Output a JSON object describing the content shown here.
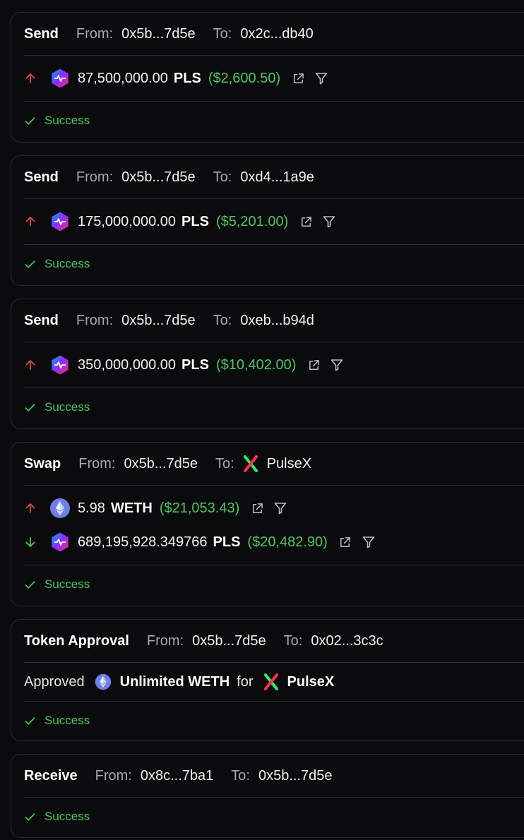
{
  "colors": {
    "success": "#4ec65f",
    "up_arrow": "#e0484b",
    "down_arrow": "#4ec65f",
    "background": "#0b0b0d"
  },
  "labels": {
    "from": "From:",
    "to": "To:"
  },
  "transactions": [
    {
      "type": "Send",
      "from": "0x5b...7d5e",
      "to": "0x2c...db40",
      "transfers": [
        {
          "direction": "up-arrow-icon",
          "token_icon": "pulsechain-icon",
          "amount": "87,500,000.00",
          "symbol": "PLS",
          "usd": "($2,600.50)"
        }
      ],
      "status": "Success"
    },
    {
      "type": "Send",
      "from": "0x5b...7d5e",
      "to": "0xd4...1a9e",
      "transfers": [
        {
          "direction": "up-arrow-icon",
          "token_icon": "pulsechain-icon",
          "amount": "175,000,000.00",
          "symbol": "PLS",
          "usd": "($5,201.00)"
        }
      ],
      "status": "Success"
    },
    {
      "type": "Send",
      "from": "0x5b...7d5e",
      "to": "0xeb...b94d",
      "transfers": [
        {
          "direction": "up-arrow-icon",
          "token_icon": "pulsechain-icon",
          "amount": "350,000,000.00",
          "symbol": "PLS",
          "usd": "($10,402.00)"
        }
      ],
      "status": "Success"
    },
    {
      "type": "Swap",
      "from": "0x5b...7d5e",
      "to": "PulseX",
      "to_icon": "pulsex-icon",
      "transfers": [
        {
          "direction": "up-arrow-icon",
          "token_icon": "ethereum-icon",
          "amount": "5.98",
          "symbol": "WETH",
          "usd": "($21,053.43)"
        },
        {
          "direction": "down-arrow-icon",
          "token_icon": "pulsechain-icon",
          "amount": "689,195,928.349766",
          "symbol": "PLS",
          "usd": "($20,482.90)"
        }
      ],
      "status": "Success"
    },
    {
      "type": "Token Approval",
      "from": "0x5b...7d5e",
      "to": "0x02...3c3c",
      "approval": {
        "prefix": "Approved",
        "token": "Unlimited WETH",
        "for": "for",
        "spender": "PulseX"
      },
      "status": "Success"
    },
    {
      "type": "Receive",
      "from": "0x8c...7ba1",
      "to": "0x5b...7d5e",
      "status": "Success"
    }
  ]
}
